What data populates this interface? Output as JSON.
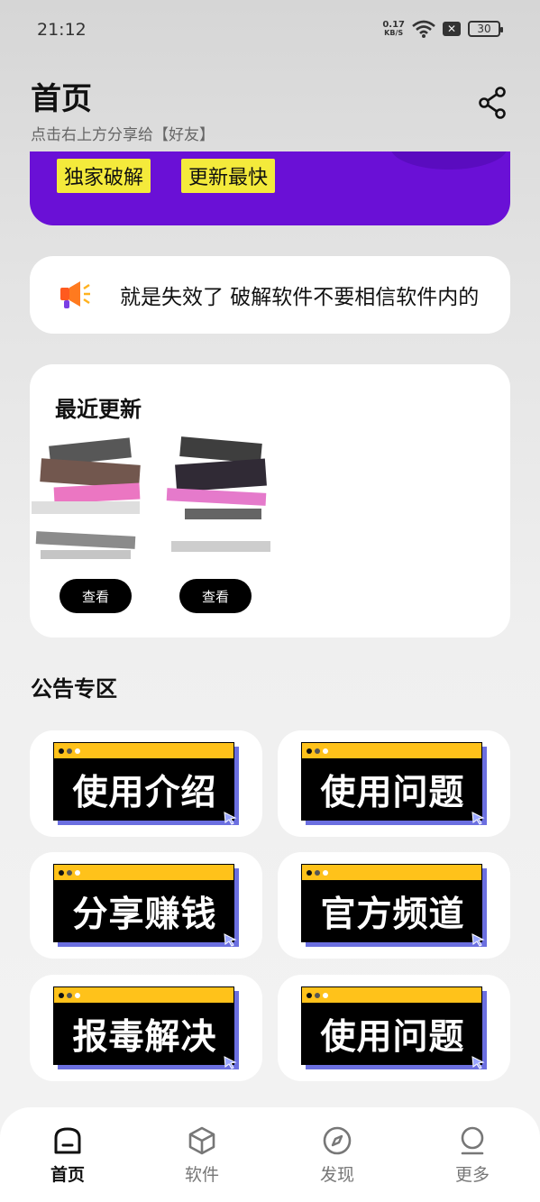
{
  "status_bar": {
    "time": "21:12",
    "net_speed_value": "0.17",
    "net_speed_unit": "KB/S",
    "battery": "30"
  },
  "header": {
    "title": "首页",
    "subtitle": "点击右上方分享给【好友】"
  },
  "banner": {
    "tags": [
      "独家破解",
      "更新最快"
    ],
    "color": "#6a10d6"
  },
  "notice": {
    "text": "就是失效了   破解软件不要相信软件内的"
  },
  "recent": {
    "title": "最近更新",
    "items": [
      {
        "button": "查看"
      },
      {
        "button": "查看"
      }
    ]
  },
  "announcements": {
    "title": "公告专区",
    "tiles": [
      "使用介绍",
      "使用问题",
      "分享赚钱",
      "官方频道",
      "报毒解决",
      "使用问题"
    ]
  },
  "bottom_nav": {
    "items": [
      {
        "label": "首页",
        "icon": "home-icon",
        "active": true
      },
      {
        "label": "软件",
        "icon": "cube-icon",
        "active": false
      },
      {
        "label": "发现",
        "icon": "compass-icon",
        "active": false
      },
      {
        "label": "更多",
        "icon": "profile-icon",
        "active": false
      }
    ]
  }
}
